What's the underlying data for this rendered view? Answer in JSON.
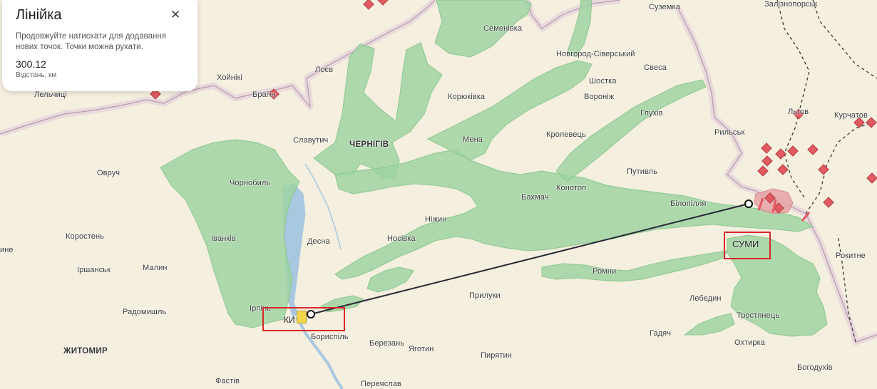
{
  "ruler_panel": {
    "title": "Лінійка",
    "close_icon": "close-icon",
    "hint": "Продовжуйте натискати для додавання нових точок. Точки можна рухати.",
    "distance_value": "300.12",
    "distance_unit": "Відстань, км"
  },
  "highlights": {
    "kyiv_label": "КИ",
    "sumy_label": "СУМИ"
  },
  "map": {
    "colors": {
      "background": "#f4efdf",
      "controlled_zone": "#9fd4a2",
      "river": "#a8c8e0",
      "border": "#b59aa8",
      "contested": "#e7a2a6",
      "marker": "#e15a62",
      "ruler_line": "#2a2a3a",
      "highlight": "#d9282a"
    },
    "places": [
      {
        "name": "Семенівка"
      },
      {
        "name": "Суземка"
      },
      {
        "name": "Залізнопорськ"
      },
      {
        "name": "Новгород-Сіверський"
      },
      {
        "name": "Лоєв"
      },
      {
        "name": "Хойнікі"
      },
      {
        "name": "Лельчиці"
      },
      {
        "name": "Брагін"
      },
      {
        "name": "Корюківка"
      },
      {
        "name": "Шостка"
      },
      {
        "name": "Свеса"
      },
      {
        "name": "Вороніж"
      },
      {
        "name": "Глухів"
      },
      {
        "name": "Славутич"
      },
      {
        "name": "ЧЕРНІГІВ"
      },
      {
        "name": "Мена"
      },
      {
        "name": "Кролевець"
      },
      {
        "name": "Рильськ"
      },
      {
        "name": "Льгов"
      },
      {
        "name": "Курчатов"
      },
      {
        "name": "Овруч"
      },
      {
        "name": "Чорнобиль"
      },
      {
        "name": "Путивль"
      },
      {
        "name": "Конотоп"
      },
      {
        "name": "Бахмач"
      },
      {
        "name": "Білопілля"
      },
      {
        "name": "Коростень"
      },
      {
        "name": "Іванків"
      },
      {
        "name": "Десна"
      },
      {
        "name": "Носівка"
      },
      {
        "name": "Ніжин"
      },
      {
        "name": "Іршанськ"
      },
      {
        "name": "Малин"
      },
      {
        "name": "Ромни"
      },
      {
        "name": "Радомишль"
      },
      {
        "name": "Ірпінь"
      },
      {
        "name": "Прилуки"
      },
      {
        "name": "Лебедин"
      },
      {
        "name": "Тростянець"
      },
      {
        "name": "Бориспіль"
      },
      {
        "name": "Гадяч"
      },
      {
        "name": "ЖИТОМИР"
      },
      {
        "name": "Березань"
      },
      {
        "name": "Яготин"
      },
      {
        "name": "Пирятин"
      },
      {
        "name": "Охтирка"
      },
      {
        "name": "Фастів"
      },
      {
        "name": "Переяслав"
      },
      {
        "name": "Богодухів"
      },
      {
        "name": "Рокитне"
      },
      {
        "name": "ине"
      }
    ]
  }
}
